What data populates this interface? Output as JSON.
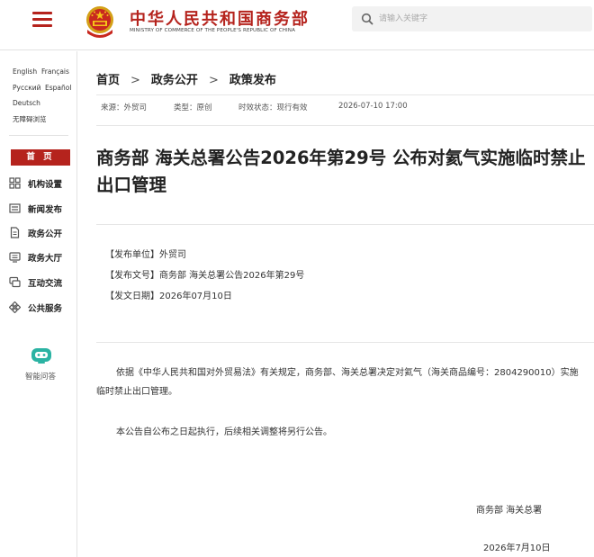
{
  "header": {
    "logo_cn": "中华人民共和国商务部",
    "logo_en": "MINISTRY OF COMMERCE OF THE PEOPLE'S REPUBLIC OF CHINA",
    "search_placeholder": "请输入关键字",
    "accent_color": "#b5231d"
  },
  "sidebar": {
    "languages": [
      "English",
      "Français",
      "Русский",
      "Español",
      "Deutsch",
      "无障碍浏览"
    ],
    "home_label": "首 页",
    "items": [
      {
        "label": "机构设置",
        "icon": "org-chart-icon"
      },
      {
        "label": "新闻发布",
        "icon": "news-icon"
      },
      {
        "label": "政务公开",
        "icon": "document-icon"
      },
      {
        "label": "政务大厅",
        "icon": "hall-icon"
      },
      {
        "label": "互动交流",
        "icon": "chat-icon"
      },
      {
        "label": "公共服务",
        "icon": "service-icon"
      }
    ],
    "assistant_label": "智能问答"
  },
  "breadcrumb": [
    "首页",
    "政务公开",
    "政策发布"
  ],
  "breadcrumb_sep": ">",
  "meta": {
    "source": "来源：外贸司",
    "type": "类型：原创",
    "status": "时效状态：现行有效",
    "date": "2026-07-10 17:00"
  },
  "article": {
    "title": "商务部 海关总署公告2026年第29号 公布对氦气实施临时禁止出口管理",
    "info": [
      "【发布单位】外贸司",
      "【发布文号】商务部 海关总署公告2026年第29号",
      "【发文日期】2026年07月10日"
    ],
    "paragraphs": [
      "依据《中华人民共和国对外贸易法》有关规定，商务部、海关总署决定对氦气（海关商品编号：2804290010）实施临时禁止出口管理。",
      "本公告自公布之日起执行，后续相关调整将另行公告。"
    ],
    "signature": "商务部 海关总署",
    "sign_date": "2026年7月10日"
  }
}
